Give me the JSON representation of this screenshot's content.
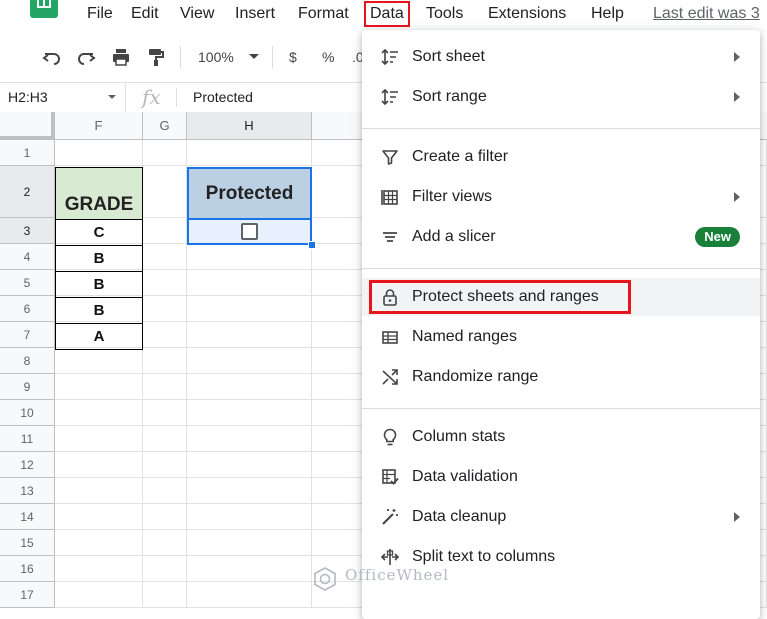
{
  "menu": {
    "items": [
      "File",
      "Edit",
      "View",
      "Insert",
      "Format",
      "Data",
      "Tools",
      "Extensions",
      "Help"
    ],
    "active": "Data",
    "last_edit": "Last edit was 3"
  },
  "toolbar": {
    "zoom": "100%",
    "currency_symbol": "$",
    "percent_symbol": "%",
    "decimal_fragment": ".0"
  },
  "formula_bar": {
    "name_box": "H2:H3",
    "fx": "fx",
    "value": "Protected"
  },
  "grid": {
    "columns": [
      "F",
      "G",
      "H"
    ],
    "rows": [
      "1",
      "2",
      "3",
      "4",
      "5",
      "6",
      "7",
      "8",
      "9",
      "10",
      "11",
      "12",
      "13",
      "14",
      "15",
      "16",
      "17"
    ],
    "grade_header": "GRADE",
    "grades": [
      "C",
      "B",
      "B",
      "B",
      "A"
    ],
    "protected_header": "Protected",
    "checkbox_checked": false
  },
  "data_menu": {
    "items": [
      {
        "label": "Sort sheet",
        "icon": "sort-icon",
        "submenu": true
      },
      {
        "label": "Sort range",
        "icon": "sort-icon",
        "submenu": true
      },
      {
        "label": "Create a filter",
        "icon": "filter-icon",
        "submenu": false
      },
      {
        "label": "Filter views",
        "icon": "filter-views-icon",
        "submenu": true
      },
      {
        "label": "Add a slicer",
        "icon": "slicer-icon",
        "submenu": false,
        "badge": "New"
      },
      {
        "label": "Protect sheets and ranges",
        "icon": "lock-icon",
        "submenu": false
      },
      {
        "label": "Named ranges",
        "icon": "named-ranges-icon",
        "submenu": false
      },
      {
        "label": "Randomize range",
        "icon": "shuffle-icon",
        "submenu": false
      },
      {
        "label": "Column stats",
        "icon": "lightbulb-icon",
        "submenu": false
      },
      {
        "label": "Data validation",
        "icon": "data-validation-icon",
        "submenu": false
      },
      {
        "label": "Data cleanup",
        "icon": "magic-wand-icon",
        "submenu": true
      },
      {
        "label": "Split text to columns",
        "icon": "split-columns-icon",
        "submenu": false
      }
    ],
    "highlighted": "Protect sheets and ranges"
  },
  "watermark": "OfficeWheel",
  "colors": {
    "highlight_red": "#e8141c",
    "selection_blue": "#1a73e8",
    "grade_header_green": "#d9ead3",
    "protected_header_blue": "#bcd0e4",
    "new_badge_green": "#188038",
    "app_green": "#23a566"
  }
}
